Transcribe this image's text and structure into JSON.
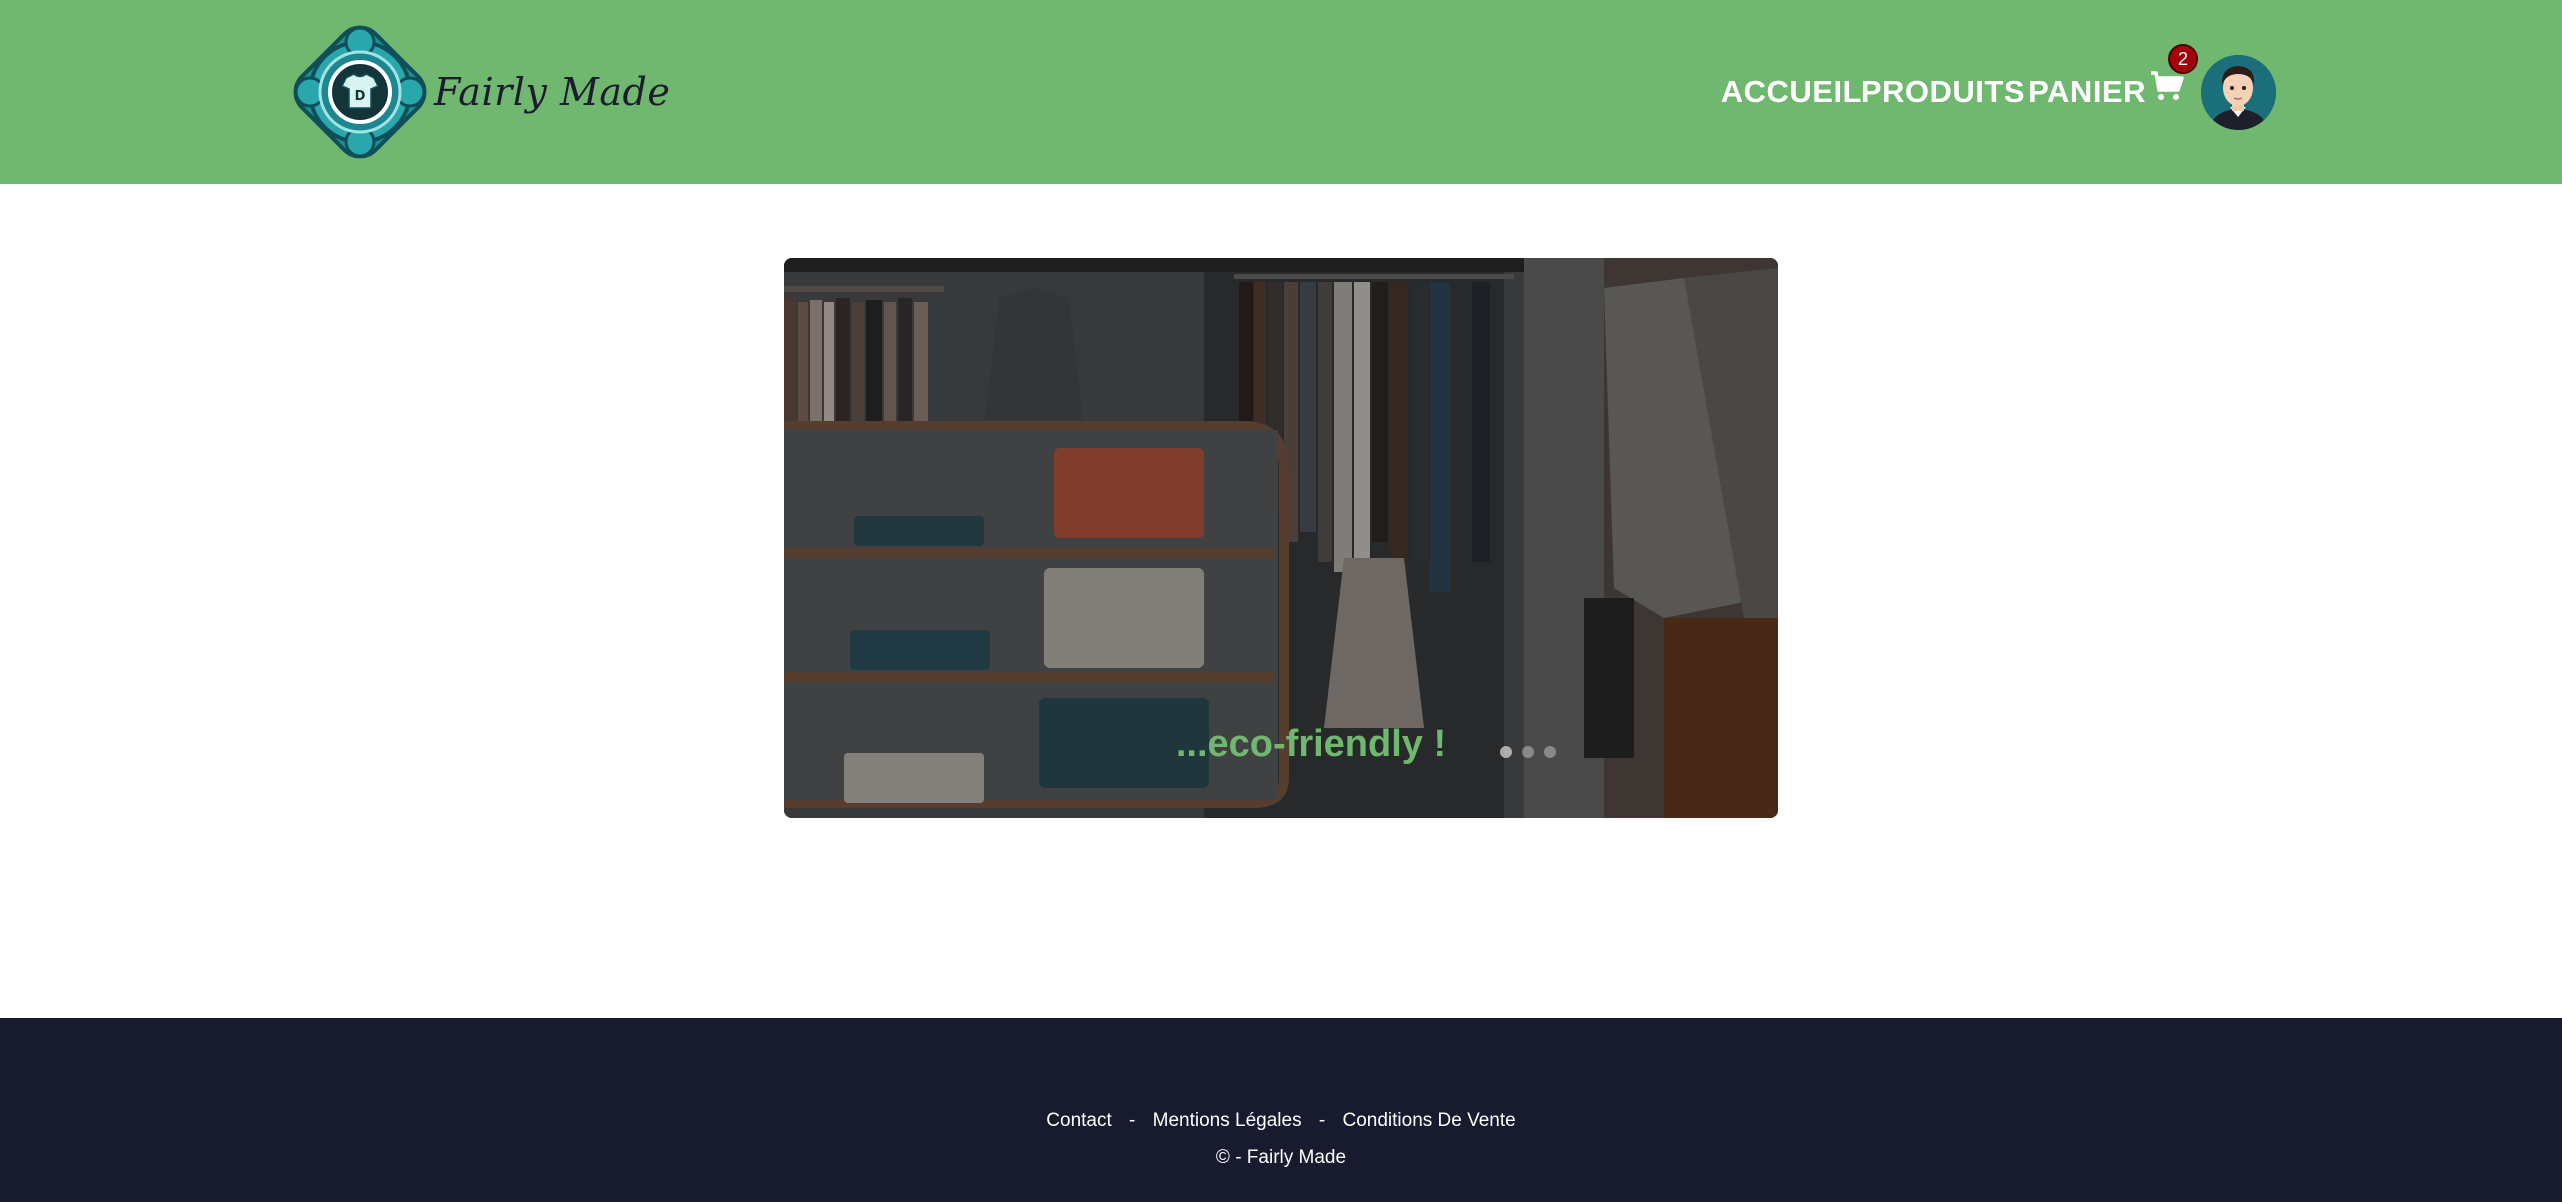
{
  "header": {
    "brand": "Fairly Made",
    "logo_icon": "tshirt-emblem-icon",
    "nav": [
      {
        "label": "ACCUEIL"
      },
      {
        "label": "PRODUITS"
      },
      {
        "label": "PANIER"
      }
    ],
    "cart_icon": "shopping-cart-icon",
    "cart_count": "2",
    "avatar_icon": "user-avatar-icon",
    "background_color": "#70b76f"
  },
  "carousel": {
    "caption": "...eco-friendly !",
    "caption_color": "#70b76f",
    "slide_count": 3,
    "active_slide": 1
  },
  "footer": {
    "links": [
      {
        "label": "Contact"
      },
      {
        "label": "Mentions Légales"
      },
      {
        "label": "Conditions De Vente"
      }
    ],
    "separator": "-",
    "copyright": "© - Fairly Made",
    "background_color": "#181a2e"
  }
}
